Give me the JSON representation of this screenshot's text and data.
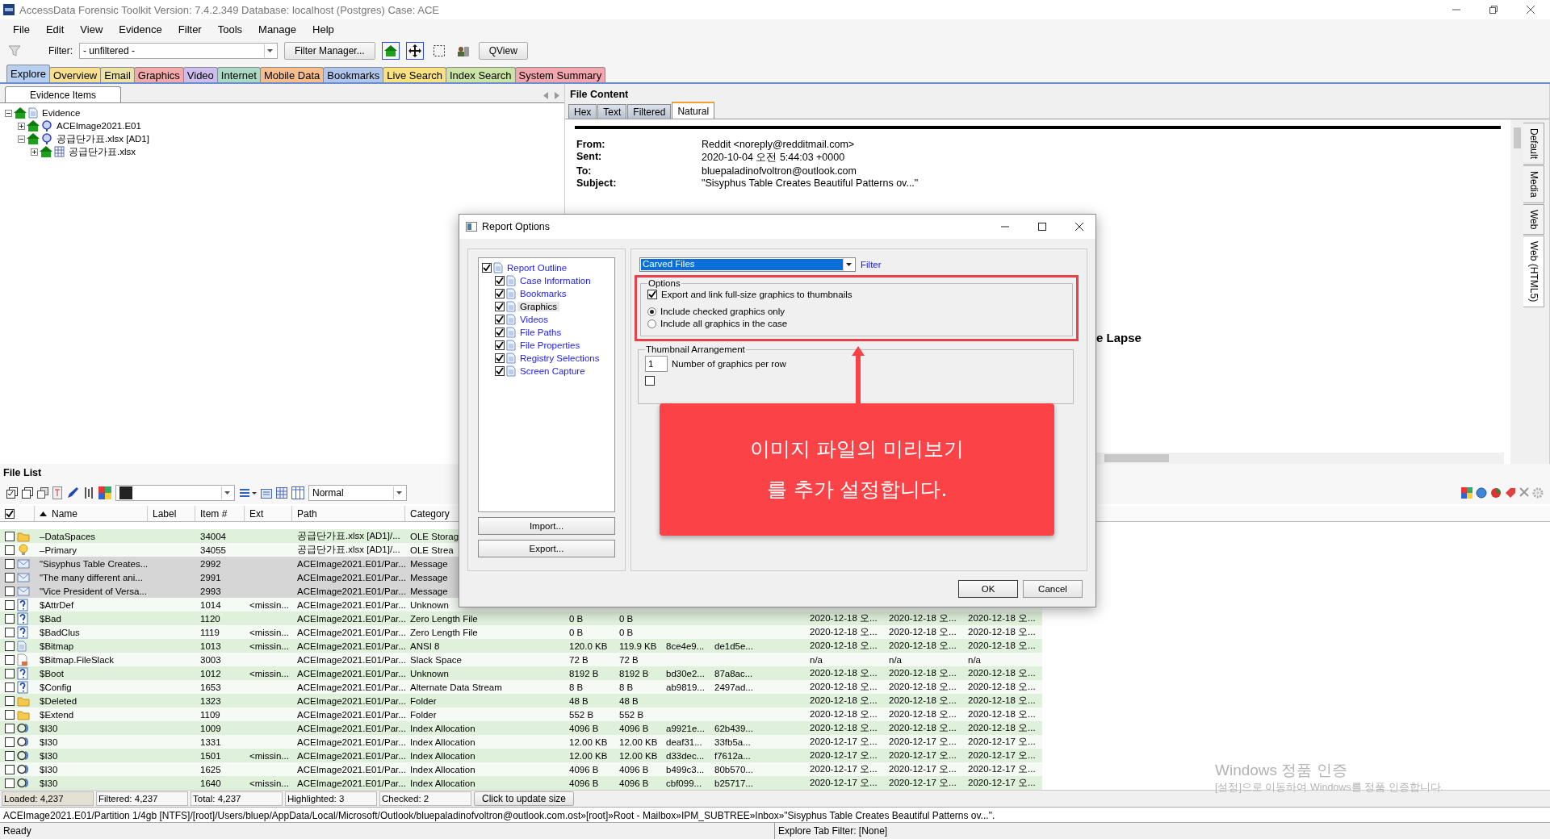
{
  "window": {
    "title": "AccessData Forensic Toolkit Version: 7.4.2.349 Database: localhost (Postgres) Case: ACE"
  },
  "menu": [
    "File",
    "Edit",
    "View",
    "Evidence",
    "Filter",
    "Tools",
    "Manage",
    "Help"
  ],
  "toolbar": {
    "filter_label": "Filter:",
    "filter_value": "- unfiltered -",
    "filter_manager": "Filter Manager...",
    "qview": "QView"
  },
  "tabs": [
    {
      "label": "Explore",
      "selected": true,
      "color": "#b7d0f2"
    },
    {
      "label": "Overview",
      "selected": false,
      "color": "#f9e08e"
    },
    {
      "label": "Email",
      "selected": false,
      "color": "#ece3a3"
    },
    {
      "label": "Graphics",
      "selected": false,
      "color": "#f2a9a9"
    },
    {
      "label": "Video",
      "selected": false,
      "color": "#cdbdec"
    },
    {
      "label": "Internet",
      "selected": false,
      "color": "#acd9c3"
    },
    {
      "label": "Mobile Data",
      "selected": false,
      "color": "#f9bd8c"
    },
    {
      "label": "Bookmarks",
      "selected": false,
      "color": "#b0c6ec"
    },
    {
      "label": "Live Search",
      "selected": false,
      "color": "#f9e27f"
    },
    {
      "label": "Index Search",
      "selected": false,
      "color": "#cbe3a4"
    },
    {
      "label": "System Summary",
      "selected": false,
      "color": "#f2a6ae"
    }
  ],
  "evidence_panel": {
    "tab": "Evidence Items",
    "tree": [
      {
        "label": "Evidence",
        "kind": "root",
        "expanded": true,
        "children": [
          {
            "label": "ACEImage2021.E01",
            "kind": "image",
            "expanded": false
          },
          {
            "label": "공급단가표.xlsx [AD1]",
            "kind": "image",
            "expanded": true,
            "children": [
              {
                "label": "공급단가표.xlsx",
                "kind": "sheet",
                "expanded": false
              }
            ]
          }
        ]
      }
    ]
  },
  "file_content": {
    "title": "File Content",
    "tabs": [
      {
        "label": "Hex",
        "selected": false
      },
      {
        "label": "Text",
        "selected": false
      },
      {
        "label": "Filtered",
        "selected": false
      },
      {
        "label": "Natural",
        "selected": true
      }
    ],
    "fields": [
      {
        "label": "From:",
        "value": "Reddit <noreply@redditmail.com>"
      },
      {
        "label": "Sent:",
        "value": "2020-10-04 오전 5:44:03 +0000"
      },
      {
        "label": "To:",
        "value": "bluepaladinofvoltron@outlook.com"
      },
      {
        "label": "Subject:",
        "value": "\"Sisyphus Table Creates Beautiful Patterns ov...\""
      }
    ],
    "heading_fragment": "e Lapse",
    "side_tabs": [
      {
        "label": "Default",
        "selected": false
      },
      {
        "label": "Media",
        "selected": false
      },
      {
        "label": "Web",
        "selected": false
      },
      {
        "label": "Web (HTML5)",
        "selected": true
      }
    ]
  },
  "file_list": {
    "title": "File List",
    "view_mode": "Normal",
    "all_checked": true,
    "columns": [
      {
        "label": "Name",
        "sorted": true
      },
      {
        "label": "Label",
        "sorted": false
      },
      {
        "label": "Item #",
        "sorted": false
      },
      {
        "label": "Ext",
        "sorted": false
      },
      {
        "label": "Path",
        "sorted": false
      },
      {
        "label": "Category",
        "sorted": false
      }
    ],
    "rows": [
      {
        "kind": "folder",
        "checked": false,
        "highlighted": false,
        "name": "–DataSpaces",
        "item": "34004",
        "path": "공급단가표.xlsx [AD1]/...",
        "category": "OLE Storag"
      },
      {
        "kind": "bulb",
        "checked": false,
        "highlighted": false,
        "name": "–Primary",
        "item": "34055",
        "path": "공급단가표.xlsx [AD1]/...",
        "category": "OLE Strea"
      },
      {
        "kind": "mail",
        "checked": false,
        "highlighted": true,
        "name": "\"Sisyphus Table Creates...",
        "item": "2992",
        "path": "ACEImage2021.E01/Par...",
        "category": "Message"
      },
      {
        "kind": "mail",
        "checked": false,
        "highlighted": true,
        "name": "\"The many different ani...",
        "item": "2991",
        "path": "ACEImage2021.E01/Par...",
        "category": "Message"
      },
      {
        "kind": "mail",
        "checked": false,
        "highlighted": true,
        "name": "\"Vice President of Versa...",
        "item": "2993",
        "path": "ACEImage2021.E01/Par...",
        "category": "Message"
      },
      {
        "kind": "unknown",
        "checked": false,
        "highlighted": false,
        "name": "$AttrDef",
        "item": "1014",
        "ext": "<missin...",
        "path": "ACEImage2021.E01/Par...",
        "category": "Unknown"
      },
      {
        "kind": "unknown",
        "checked": false,
        "highlighted": false,
        "name": "$Bad",
        "item": "1120",
        "path": "ACEImage2021.E01/Par...",
        "category": "Zero Length File",
        "column_9": "0 B",
        "column_10": "0 B",
        "column_13": "2020-12-18 오...",
        "column_14": "2020-12-18 오...",
        "column_15": "2020-12-18 오..."
      },
      {
        "kind": "unknown",
        "checked": false,
        "highlighted": false,
        "name": "$BadClus",
        "item": "1119",
        "ext": "<missin...",
        "path": "ACEImage2021.E01/Par...",
        "category": "Zero Length File",
        "column_9": "0 B",
        "column_10": "0 B",
        "column_13": "2020-12-18 오...",
        "column_14": "2020-12-18 오...",
        "column_15": "2020-12-18 오..."
      },
      {
        "kind": "document",
        "checked": false,
        "highlighted": false,
        "name": "$Bitmap",
        "item": "1013",
        "ext": "<missin...",
        "path": "ACEImage2021.E01/Par...",
        "category": "ANSI 8",
        "column_9": "120.0 KB",
        "column_10": "119.9 KB",
        "column_11": "8ce4e9...",
        "column_12": "de1d5e...",
        "column_13": "2020-12-18 오...",
        "column_14": "2020-12-18 오...",
        "column_15": "2020-12-18 오..."
      },
      {
        "kind": "slack",
        "checked": false,
        "highlighted": false,
        "name": "$Bitmap.FileSlack",
        "item": "3003",
        "path": "ACEImage2021.E01/Par...",
        "category": "Slack Space",
        "column_9": "72 B",
        "column_10": "72 B",
        "column_13": "n/a",
        "column_14": "n/a",
        "column_15": "n/a"
      },
      {
        "kind": "unknown",
        "checked": false,
        "highlighted": false,
        "name": "$Boot",
        "item": "1012",
        "ext": "<missin...",
        "path": "ACEImage2021.E01/Par...",
        "category": "Unknown",
        "column_9": "8192 B",
        "column_10": "8192 B",
        "column_11": "bd30e2...",
        "column_12": "87a8ac...",
        "column_13": "2020-12-18 오...",
        "column_14": "2020-12-18 오...",
        "column_15": "2020-12-18 오..."
      },
      {
        "kind": "unknown",
        "checked": false,
        "highlighted": false,
        "name": "$Config",
        "item": "1653",
        "path": "ACEImage2021.E01/Par...",
        "category": "Alternate Data Stream",
        "column_9": "8 B",
        "column_10": "8 B",
        "column_11": "ab9819...",
        "column_12": "2497ad...",
        "column_13": "2020-12-18 오...",
        "column_14": "2020-12-18 오...",
        "column_15": "2020-12-18 오..."
      },
      {
        "kind": "folder",
        "checked": false,
        "highlighted": false,
        "name": "$Deleted",
        "item": "1323",
        "path": "ACEImage2021.E01/Par...",
        "category": "Folder",
        "column_9": "48 B",
        "column_10": "48 B",
        "column_13": "2020-12-18 오...",
        "column_14": "2020-12-18 오...",
        "column_15": "2020-12-18 오..."
      },
      {
        "kind": "folder",
        "checked": false,
        "highlighted": false,
        "name": "$Extend",
        "item": "1109",
        "path": "ACEImage2021.E01/Par...",
        "category": "Folder",
        "column_9": "552 B",
        "column_10": "552 B",
        "column_13": "2020-12-18 오...",
        "column_14": "2020-12-18 오...",
        "column_15": "2020-12-18 오..."
      },
      {
        "kind": "index",
        "checked": false,
        "highlighted": false,
        "name": "$I30",
        "item": "1009",
        "path": "ACEImage2021.E01/Par...",
        "category": "Index Allocation",
        "column_9": "4096 B",
        "column_10": "4096 B",
        "column_11": "a9921e...",
        "column_12": "62b439...",
        "column_13": "2020-12-18 오...",
        "column_14": "2020-12-18 오...",
        "column_15": "2020-12-18 오..."
      },
      {
        "kind": "index",
        "checked": false,
        "highlighted": false,
        "name": "$I30",
        "item": "1331",
        "path": "ACEImage2021.E01/Par...",
        "category": "Index Allocation",
        "column_9": "12.00 KB",
        "column_10": "12.00 KB",
        "column_11": "deaf31...",
        "column_12": "33fb5a...",
        "column_13": "2020-12-17 오...",
        "column_14": "2020-12-17 오...",
        "column_15": "2020-12-17 오..."
      },
      {
        "kind": "index",
        "checked": false,
        "highlighted": false,
        "name": "$I30",
        "item": "1501",
        "ext": "<missin...",
        "path": "ACEImage2021.E01/Par...",
        "category": "Index Allocation",
        "column_9": "12.00 KB",
        "column_10": "12.00 KB",
        "column_11": "d33dec...",
        "column_12": "f7612a...",
        "column_13": "2020-12-17 오...",
        "column_14": "2020-12-17 오...",
        "column_15": "2020-12-17 오..."
      },
      {
        "kind": "index",
        "checked": false,
        "highlighted": false,
        "name": "$I30",
        "item": "1625",
        "path": "ACEImage2021.E01/Par...",
        "category": "Index Allocation",
        "column_9": "4096 B",
        "column_10": "4096 B",
        "column_11": "b499c3...",
        "column_12": "80b570...",
        "column_13": "2020-12-17 오...",
        "column_14": "2020-12-17 오...",
        "column_15": "2020-12-17 오..."
      },
      {
        "kind": "index",
        "checked": false,
        "highlighted": false,
        "name": "$I30",
        "item": "1640",
        "ext": "<missin...",
        "path": "ACEImage2021.E01/Par...",
        "category": "Index Allocation",
        "column_9": "4096 B",
        "column_10": "4096 B",
        "column_11": "cbf099...",
        "column_12": "b25717...",
        "column_13": "2020-12-17 오...",
        "column_14": "2020-12-17 오...",
        "column_15": "2020-12-17 오..."
      }
    ],
    "counts": [
      "Loaded: 4,237",
      "Filtered: 4,237",
      "Total: 4,237",
      "Highlighted: 3",
      "Checked: 2"
    ],
    "update_button": "Click to update size"
  },
  "path_bar": "ACEImage2021.E01/Partition 1/4gb [NTFS]/[root]/Users/bluep/AppData/Local/Microsoft/Outlook/bluepaladinofvoltron@outlook.com.ost»[root]»Root - Mailbox»IPM_SUBTREE»Inbox»\"Sisyphus Table Creates Beautiful Patterns ov...\".",
  "status_bar": {
    "left": "Ready",
    "right": "Explore Tab Filter: [None]"
  },
  "dialog": {
    "title": "Report Options",
    "outline": [
      {
        "label": "Report Outline",
        "checked": true,
        "selected": false,
        "children": [
          {
            "label": "Case Information",
            "checked": true,
            "selected": false
          },
          {
            "label": "Bookmarks",
            "checked": true,
            "selected": false
          },
          {
            "label": "Graphics",
            "checked": true,
            "selected": true
          },
          {
            "label": "Videos",
            "checked": true,
            "selected": false
          },
          {
            "label": "File Paths",
            "checked": true,
            "selected": false
          },
          {
            "label": "File Properties",
            "checked": true,
            "selected": false
          },
          {
            "label": "Registry Selections",
            "checked": true,
            "selected": false
          },
          {
            "label": "Screen Capture",
            "checked": true,
            "selected": false
          }
        ]
      }
    ],
    "import": "Import...",
    "export": "Export...",
    "source": "Carved Files",
    "filter_link": "Filter",
    "options_title": "Options",
    "export_option": {
      "label": "Export and link full-size graphics to thumbnails",
      "checked": true
    },
    "include": [
      {
        "label": "Include checked graphics only",
        "selected": true
      },
      {
        "label": "Include all graphics in the case",
        "selected": false
      }
    ],
    "thumbnail_title": "Thumbnail Arrangement",
    "per_row": "1",
    "per_row_label": "Number of graphics per row",
    "extra_option": {
      "checked": false
    },
    "ok": "OK",
    "cancel": "Cancel"
  },
  "callout": {
    "text": "이미지 파일의 미리보기를 추가 설정합니다."
  },
  "activation_notice": {
    "title": "Windows 정품 인증",
    "text": "[설정]으로 이동하여 Windows를 정품 인증합니다."
  }
}
